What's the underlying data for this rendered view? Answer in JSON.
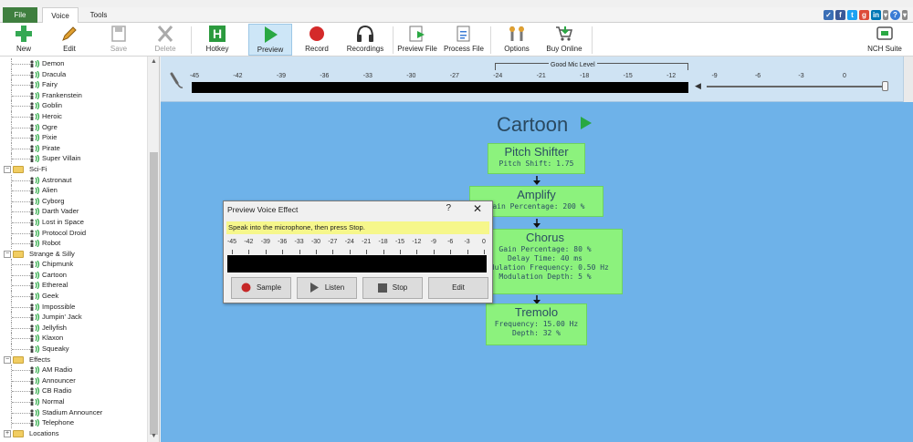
{
  "menu": {
    "file": "File",
    "voice": "Voice",
    "tools": "Tools"
  },
  "toolbar": {
    "new": "New",
    "edit": "Edit",
    "save": "Save",
    "delete": "Delete",
    "hotkey": "Hotkey",
    "preview": "Preview",
    "record": "Record",
    "recordings": "Recordings",
    "preview_file": "Preview File",
    "process_file": "Process File",
    "options": "Options",
    "buy_online": "Buy Online",
    "nch_suite": "NCH Suite"
  },
  "sidebar": {
    "groups": [
      {
        "category": "",
        "voices": [
          "Demon",
          "Dracula",
          "Fairy",
          "Frankenstein",
          "Goblin",
          "Heroic",
          "Ogre",
          "Pixie",
          "Pirate",
          "Super Villain"
        ]
      },
      {
        "category": "Sci-Fi",
        "voices": [
          "Astronaut",
          "Alien",
          "Cyborg",
          "Darth Vader",
          "Lost in Space",
          "Protocol Droid",
          "Robot"
        ]
      },
      {
        "category": "Strange & Silly",
        "voices": [
          "Chipmunk",
          "Cartoon",
          "Ethereal",
          "Geek",
          "Impossible",
          "Jumpin' Jack",
          "Jellyfish",
          "Klaxon",
          "Squeaky"
        ]
      },
      {
        "category": "Effects",
        "voices": [
          "AM Radio",
          "Announcer",
          "CB Radio",
          "Normal",
          "Stadium Announcer",
          "Telephone"
        ]
      },
      {
        "category": "Locations",
        "voices": []
      }
    ]
  },
  "level": {
    "ticks": [
      "-45",
      "-42",
      "-39",
      "-36",
      "-33",
      "-30",
      "-27",
      "-24",
      "-21",
      "-18",
      "-15",
      "-12",
      "-9",
      "-6",
      "-3",
      "0"
    ],
    "good_mic_label": "Good Mic Level"
  },
  "effect": {
    "title": "Cartoon",
    "chain": [
      {
        "name": "Pitch Shifter",
        "params": [
          "Pitch Shift: 1.75"
        ]
      },
      {
        "name": "Amplify",
        "params": [
          "Gain Percentage: 200 %"
        ]
      },
      {
        "name": "Chorus",
        "params": [
          "Gain Percentage: 80 %",
          "Delay Time: 40 ms",
          "Modulation Frequency: 0.50 Hz",
          "Modulation Depth: 5 %"
        ]
      },
      {
        "name": "Tremolo",
        "params": [
          "Frequency: 15.00 Hz",
          "Depth: 32 %"
        ]
      }
    ]
  },
  "dialog": {
    "title": "Preview Voice Effect",
    "help": "?",
    "close": "✕",
    "instruction": "Speak into the microphone, then press Stop.",
    "ticks": [
      "-45",
      "-42",
      "-39",
      "-36",
      "-33",
      "-30",
      "-27",
      "-24",
      "-21",
      "-18",
      "-15",
      "-12",
      "-9",
      "-6",
      "-3",
      "0"
    ],
    "buttons": {
      "sample": "Sample",
      "listen": "Listen",
      "stop": "Stop",
      "edit": "Edit"
    }
  },
  "colors": {
    "canvas": "#6eb2e9",
    "effect_box": "#8cf27d",
    "file_menu": "#3f7f3f",
    "instruction_bg": "#f6f78b"
  }
}
